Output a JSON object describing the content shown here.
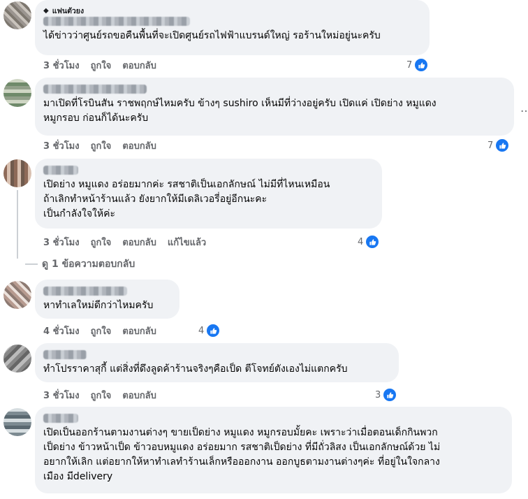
{
  "colors": {
    "like": "#1877f2",
    "meta_text": "#65676b",
    "bubble": "#f0f2f5"
  },
  "actions": {
    "time_3h": "3 ชั่วโมง",
    "time_4h": "4 ชั่วโมง",
    "like": "ถูกใจ",
    "reply": "ตอบกลับ",
    "edited": "แก้ไขแล้ว"
  },
  "comments": [
    {
      "badge": "แฟนตัวยง",
      "text": "ได้ข่าวว่าศูนย์รถขอคืนพื้นที่จะเปิดศูนย์รถไฟฟ้าแบรนด์ใหญ่ รอร้านใหม่อยู่นะครับ",
      "reactions": "7"
    },
    {
      "text": "มาเปิดที่โรบินสัน ราชพฤกษ์ไหมครับ ข้างๆ sushiro เห็นมีที่ว่างอยู่ครับ เปิดแค่ เปิดย่าง หมูแดง\nหมูกรอบ ก่อนก็ได้นะครับ",
      "reactions": "7"
    },
    {
      "text": "เปิดย่าง หมูแดง อร่อยมากค่ะ รสชาติเป็นเอกลักษณ์ ไม่มีที่ไหนเหมือน\nถ้าเลิกทำหน้าร้านแล้ว ยังยากให้มีเดลิเวอรี่อยู่อีกนะคะ\nเป็นกำลังใจให้ค่ะ",
      "reactions": "4"
    },
    {
      "text": "หาทำเลใหม่ดีกว่าไหมครับ",
      "reactions": "4"
    },
    {
      "text": "ทำโปรราคาสุกี้ แต่สิ่งที่ดึงลูดค้าร้านจริงๆคือเป็ด ตีโจทย์ตังเองไม่แตกครับ",
      "reactions": "3"
    },
    {
      "text": "เปิดเป็นออกร้านตามงานต่างๆ ขายเป็ดย่าง หมูแดง หมูกรอบมั้ยคะ เพราะว่าเมื่อตอนเด็กกินพวก\nเป็ดย่าง ข้าวหน้าเป็ด ข้าวอบหมูแดง อร่อยมาก รสชาติเป็ดย่าง ที่มีถั่วลิสง เป็นเอกลักษณ์ด้วย ไม่\nอยากให้เลิก แต่อยากให้หาทำเลทำร้านเล็กหรือออกงาน ออกบูธตามงานต่างๆค่ะ ที่อยู่ในใจกลาง\nเมือง มีdelivery"
    }
  ],
  "view_replies": "ดู 1 ข้อความตอบกลับ"
}
